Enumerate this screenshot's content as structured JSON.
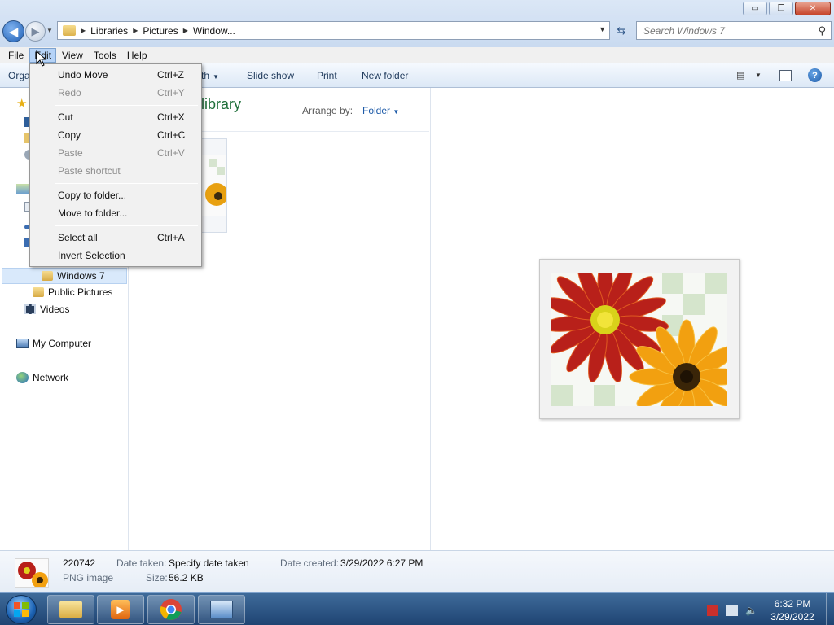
{
  "window": {
    "controls": {
      "minimize": "▭",
      "maximize": "❐",
      "close": "✕"
    }
  },
  "address": {
    "crumbs": [
      "Libraries",
      "Pictures",
      "Window..."
    ]
  },
  "search": {
    "placeholder": "Search Windows 7"
  },
  "menubar": {
    "file": "File",
    "edit": "Edit",
    "view": "View",
    "tools": "Tools",
    "help": "Help"
  },
  "cmdbar": {
    "organize": "Orga",
    "share": "th",
    "slideshow": "Slide show",
    "print": "Print",
    "new_folder": "New folder"
  },
  "navpane": {
    "windows7": "Windows 7",
    "public_pictures": "Public Pictures",
    "videos": "Videos",
    "my_computer": "My Computer",
    "network": "Network"
  },
  "content": {
    "library_title": "library",
    "arrange_label": "Arrange by:",
    "arrange_value": "Folder"
  },
  "edit_menu": {
    "undo": {
      "label": "Undo Move",
      "shortcut": "Ctrl+Z"
    },
    "redo": {
      "label": "Redo",
      "shortcut": "Ctrl+Y"
    },
    "cut": {
      "label": "Cut",
      "shortcut": "Ctrl+X"
    },
    "copy": {
      "label": "Copy",
      "shortcut": "Ctrl+C"
    },
    "paste": {
      "label": "Paste",
      "shortcut": "Ctrl+V"
    },
    "paste_shortcut": {
      "label": "Paste shortcut"
    },
    "copy_to_folder": {
      "label": "Copy to folder..."
    },
    "move_to_folder": {
      "label": "Move to folder..."
    },
    "select_all": {
      "label": "Select all",
      "shortcut": "Ctrl+A"
    },
    "invert_selection": {
      "label": "Invert Selection"
    }
  },
  "details": {
    "name": "220742",
    "type": "PNG image",
    "date_taken_label": "Date taken:",
    "date_taken_value": "Specify date taken",
    "size_label": "Size:",
    "size_value": "56.2 KB",
    "date_created_label": "Date created:",
    "date_created_value": "3/29/2022 6:27 PM"
  },
  "taskbar": {
    "time": "6:32 PM",
    "date": "3/29/2022"
  },
  "icons": {
    "back": "back-arrow-icon",
    "forward": "forward-arrow-icon",
    "search": "magnifier-icon",
    "help": "help-icon"
  },
  "colors": {
    "accent": "#1e5ba8",
    "library_title": "#1f6f3a",
    "taskbar": "#1f4472"
  }
}
